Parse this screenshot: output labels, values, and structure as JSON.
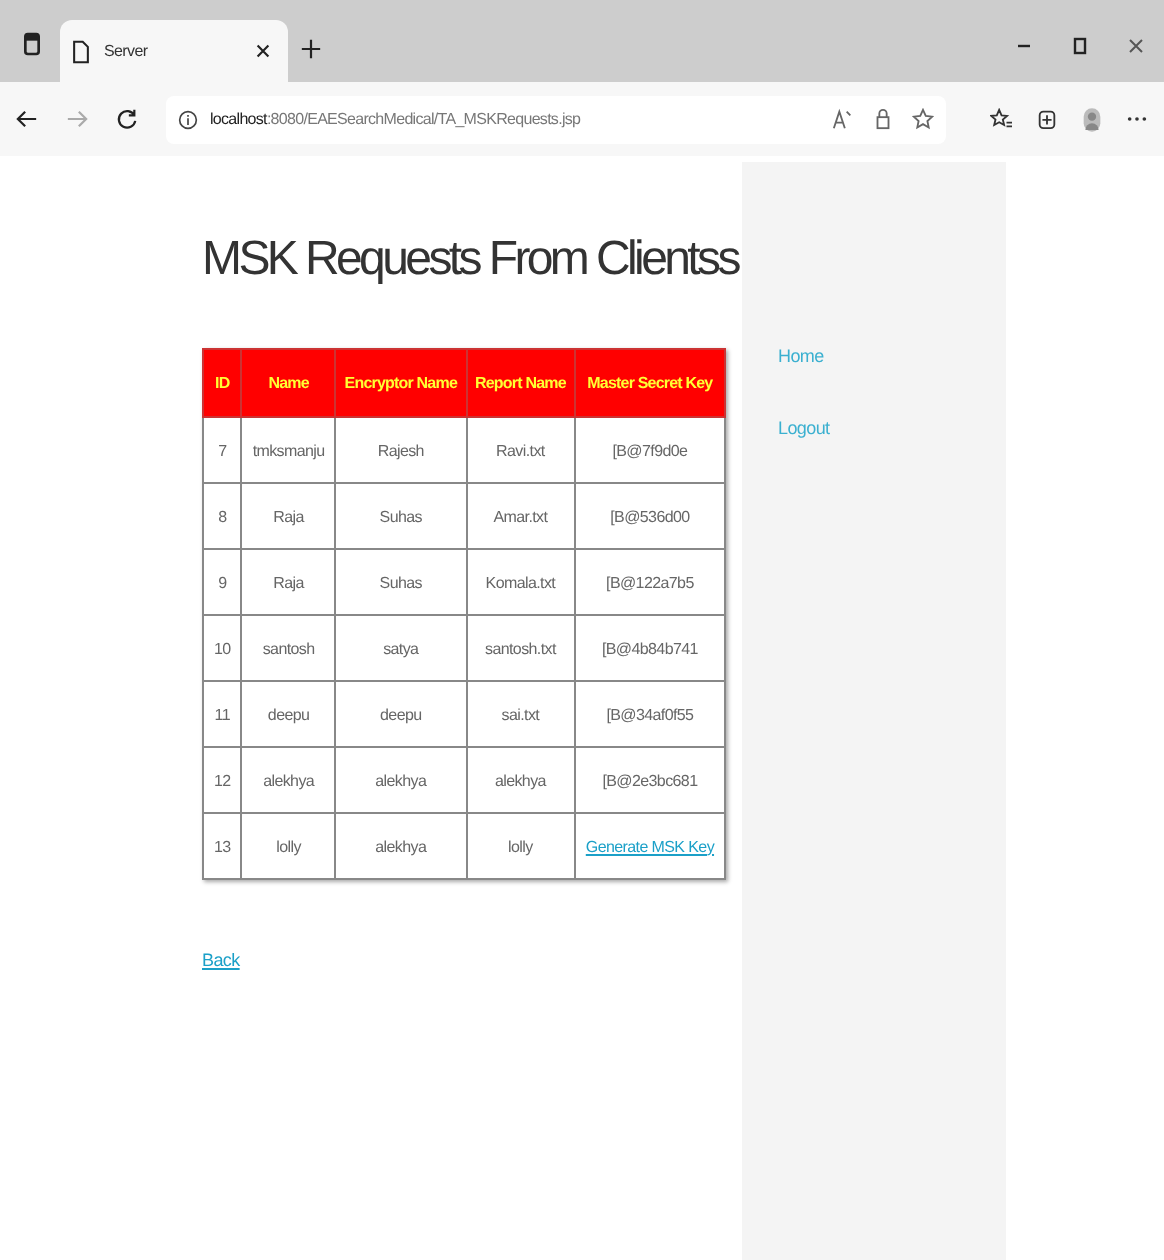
{
  "browser": {
    "tab_title": "Server",
    "url_host": "localhost",
    "url_rest": ":8080/EAESearchMedical/TA_MSKRequests.jsp"
  },
  "page": {
    "title": "MSK Requests From Clientss",
    "table": {
      "columns": [
        "ID",
        "Name",
        "Encryptor Name",
        "Report Name",
        "Master Secret Key"
      ],
      "rows": [
        {
          "id": "7",
          "name": "tmksmanju",
          "encryptor": "Rajesh",
          "report": "Ravi.txt",
          "key": {
            "kind": "text",
            "text": "[B@7f9d0e"
          }
        },
        {
          "id": "8",
          "name": "Raja",
          "encryptor": "Suhas",
          "report": "Amar.txt",
          "key": {
            "kind": "text",
            "text": "[B@536d00"
          }
        },
        {
          "id": "9",
          "name": "Raja",
          "encryptor": "Suhas",
          "report": "Komala.txt",
          "key": {
            "kind": "text",
            "text": "[B@122a7b5"
          }
        },
        {
          "id": "10",
          "name": "santosh",
          "encryptor": "satya",
          "report": "santosh.txt",
          "key": {
            "kind": "text",
            "text": "[B@4b84b741"
          }
        },
        {
          "id": "11",
          "name": "deepu",
          "encryptor": "deepu",
          "report": "sai.txt",
          "key": {
            "kind": "text",
            "text": "[B@34af0f55"
          }
        },
        {
          "id": "12",
          "name": "alekhya",
          "encryptor": "alekhya",
          "report": "alekhya",
          "key": {
            "kind": "text",
            "text": "[B@2e3bc681"
          }
        },
        {
          "id": "13",
          "name": "lolly",
          "encryptor": "alekhya",
          "report": "lolly",
          "key": {
            "kind": "link",
            "text": "Generate MSK Key"
          }
        }
      ]
    },
    "back_link": "Back"
  },
  "sidebar": {
    "items": [
      "Home",
      "Logout"
    ]
  }
}
